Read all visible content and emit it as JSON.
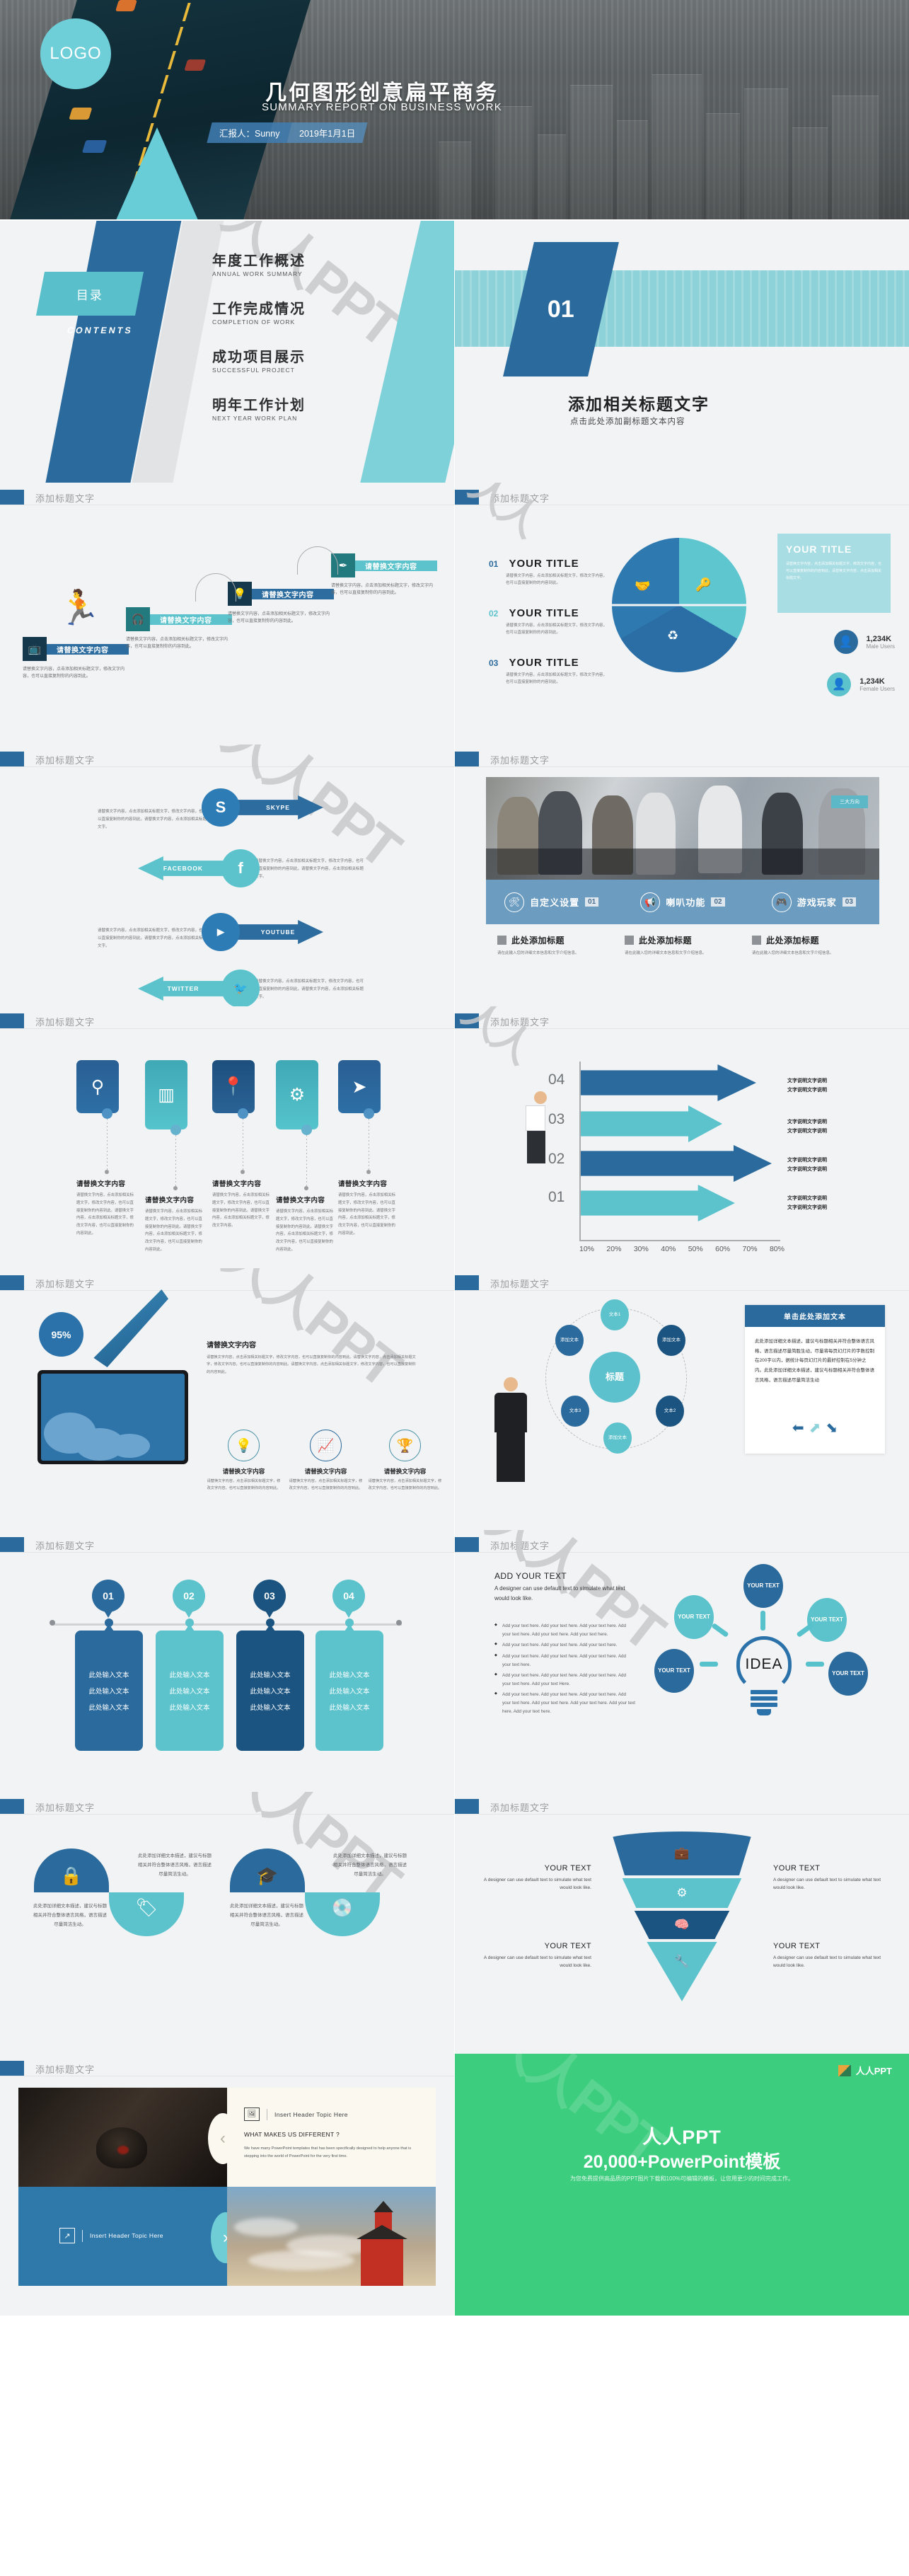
{
  "title_slide": {
    "logo": "LOGO",
    "main_title": "几何图形创意扁平商务",
    "subtitle": "SUMMARY REPORT ON BUSINESS WORK",
    "presenter": "汇报人：Sunny",
    "date": "2019年1月1日"
  },
  "contents_slide": {
    "tag": "目录",
    "contents_label": "CONTENTS",
    "items": [
      {
        "cn": "年度工作概述",
        "en": "ANNUAL WORK SUMMARY"
      },
      {
        "cn": "工作完成情况",
        "en": "COMPLETION OF WORK"
      },
      {
        "cn": "成功项目展示",
        "en": "SUCCESSFUL PROJECT"
      },
      {
        "cn": "明年工作计划",
        "en": "NEXT YEAR WORK PLAN"
      }
    ]
  },
  "section_slide": {
    "number": "01",
    "title": "添加相关标题文字",
    "subtitle": "点击此处添加副标题文本内容"
  },
  "common": {
    "slide_title": "添加标题文字",
    "replace_text": "请替换文字内容",
    "body_text": "请替换文字内容，点击添加相关标题文字，修改文字内容，也可以直接复制你的内容到此。"
  },
  "steps_slide": {
    "title": "添加标题文字",
    "steps": [
      {
        "icon": "tv-icon",
        "glyph": "📺",
        "label": "请替换文字内容",
        "desc": "请替换文字内容，点击添加相关标题文字，修改文字内容，也可以直接复制你的内容到此。"
      },
      {
        "icon": "support-icon",
        "glyph": "🎧",
        "label": "请替换文字内容",
        "desc": "请替换文字内容，点击添加相关标题文字，修改文字内容，也可以直接复制你的内容到此。"
      },
      {
        "icon": "bulb-icon",
        "glyph": "💡",
        "label": "请替换文字内容",
        "desc": "请替换文字内容，点击添加相关标题文字，修改文字内容，也可以直接复制你的内容到此。"
      },
      {
        "icon": "pen-icon",
        "glyph": "✒",
        "label": "请替换文字内容",
        "desc": "请替换文字内容，点击添加相关标题文字，修改文字内容，也可以直接复制你的内容到此。"
      }
    ]
  },
  "pie_slide": {
    "title": "添加标题文字",
    "items": [
      {
        "num": "01",
        "title": "YOUR TITLE",
        "desc": "请替换文字内容，点击添加相关标题文字，修改文字内容，也可以直接复制你的内容到此。"
      },
      {
        "num": "02",
        "title": "YOUR TITLE",
        "desc": "请替换文字内容，点击添加相关标题文字，修改文字内容，也可以直接复制你的内容到此。"
      },
      {
        "num": "03",
        "title": "YOUR TITLE",
        "desc": "请替换文字内容，点击添加相关标题文字，修改文字内容，也可以直接复制你的内容到此。"
      }
    ],
    "card_title": "YOUR TITLE",
    "card_body": "请替换文字内容，点击添加相关标题文字，修改文字内容，也可以直接复制你的内容到此，请替换文字内容，点击添加相关标题文字。",
    "stats": [
      {
        "value": "1,234K",
        "label": "Male Users"
      },
      {
        "value": "1,234K",
        "label": "Female Users"
      }
    ]
  },
  "social_slide": {
    "title": "添加标题文字",
    "rows": [
      {
        "network": "SKYPE",
        "icon": "skype-icon",
        "glyph": "S",
        "dir": "right",
        "desc": "请替换文字内容，点击添加相关标题文字，修改文字内容，也可以直接复制你的内容到此，请替换文字内容，点击添加相关标题文字。"
      },
      {
        "network": "FACEBOOK",
        "icon": "facebook-icon",
        "glyph": "f",
        "dir": "left",
        "desc": "请替换文字内容，点击添加相关标题文字，修改文字内容，也可以直接复制你的内容到此，请替换文字内容，点击添加相关标题文字。"
      },
      {
        "network": "YOUTUBE",
        "icon": "youtube-icon",
        "glyph": "▶",
        "dir": "right",
        "desc": "请替换文字内容，点击添加相关标题文字，修改文字内容，也可以直接复制你的内容到此，请替换文字内容，点击添加相关标题文字。"
      },
      {
        "network": "TWITTER",
        "icon": "twitter-icon",
        "glyph": "🐦",
        "dir": "left",
        "desc": "请替换文字内容，点击添加相关标题文字，修改文字内容，也可以直接复制你的内容到此，请替换文字内容，点击添加相关标题文字。"
      }
    ]
  },
  "meeting_slide": {
    "title": "添加标题文字",
    "photo_tag": "三大方向",
    "bar_items": [
      {
        "icon": "tools-icon",
        "glyph": "🛠",
        "label": "自定义设置",
        "num": "01"
      },
      {
        "icon": "megaphone-icon",
        "glyph": "📢",
        "label": "喇叭功能",
        "num": "02"
      },
      {
        "icon": "gamepad-icon",
        "glyph": "🎮",
        "label": "游戏玩家",
        "num": "03"
      }
    ],
    "columns": [
      {
        "head": "此处添加标题",
        "body": "请在此输入您的详细文本信息和文字介绍信息。"
      },
      {
        "head": "此处添加标题",
        "body": "请在此输入您的详细文本信息和文字介绍信息。"
      },
      {
        "head": "此处添加标题",
        "body": "请在此输入您的详细文本信息和文字介绍信息。"
      }
    ]
  },
  "icons5_slide": {
    "title": "添加标题文字",
    "items": [
      {
        "icon": "bulb-pin-icon",
        "glyph": "♀",
        "title": "请替换文字内容",
        "body": "请替换文字内容，点击添加相关标题文字，修改文字内容，也可以直接复制你的内容到此。请替换文字内容，点击添加相关标题文字，修改文字内容，也可以直接复制你的内容到此。"
      },
      {
        "icon": "bar-chart-icon",
        "glyph": "▥",
        "title": "请替换文字内容",
        "body": "请替换文字内容，点击添加相关标题文字，修改文字内容，也可以直接复制你的内容到此。请替换文字内容，点击添加相关标题文字，修改文字内容，也可以直接复制你的内容到此。"
      },
      {
        "icon": "map-pin-icon",
        "glyph": "📍",
        "title": "请替换文字内容",
        "body": "请替换文字内容，点击添加相关标题文字，修改文字内容，也可以直接复制你的内容到此。请替换文字内容，点击添加相关标题文字，修改文字内容。"
      },
      {
        "icon": "gear-icon",
        "glyph": "⚙",
        "title": "请替换文字内容",
        "body": "请替换文字内容，点击添加相关标题文字，修改文字内容，也可以直接复制你的内容到此。请替换文字内容，点击添加相关标题文字，修改文字内容，也可以直接复制你的内容到此。"
      },
      {
        "icon": "paper-plane-icon",
        "glyph": "➤",
        "title": "请替换文字内容",
        "body": "请替换文字内容，点击添加相关标题文字，修改文字内容，也可以直接复制你的内容到此。请替换文字内容，点击添加相关标题文字，修改文字内容，也可以直接复制你的内容到此。"
      }
    ]
  },
  "arrow_chart_slide": {
    "title": "添加标题文字",
    "annotations": [
      "文字说明文字说明\n文字说明文字说明",
      "文字说明文字说明\n文字说明文字说明",
      "文字说明文字说明\n文字说明文字说明",
      "文字说明文字说明\n文字说明文字说明"
    ]
  },
  "rocket_slide": {
    "title": "添加标题文字",
    "badge": "95%",
    "heading": "请替换文字内容",
    "body": "请替换文字内容，点击添加相关标题文字，修改文字内容，也可以直接复制你的内容到此。请替换文字内容，点击添加相关标题文字，修改文字内容，也可以直接复制你的内容到此。请替换文字内容，点击添加相关标题文字，修改文字内容，也可以直接复制你的内容到此。",
    "cards": [
      {
        "icon": "bulb-icon",
        "glyph": "💡",
        "title": "请替换文字内容",
        "body": "请替换文字内容，点击添加相关标题文字，修改文字内容，也可以直接复制你的内容到此。"
      },
      {
        "icon": "growth-chart-icon",
        "glyph": "📈",
        "title": "请替换文字内容",
        "body": "请替换文字内容，点击添加相关标题文字，修改文字内容，也可以直接复制你的内容到此。"
      },
      {
        "icon": "trophy-icon",
        "glyph": "🏆",
        "title": "请替换文字内容",
        "body": "请替换文字内容，点击添加相关标题文字，修改文字内容，也可以直接复制你的内容到此。"
      }
    ]
  },
  "mindmap_slide": {
    "title": "添加标题文字",
    "center": "标题",
    "nodes": [
      "文本1",
      "添加文本",
      "添加文本",
      "文本3",
      "文本2",
      "添加文本"
    ],
    "card_header": "单击此处添加文本",
    "card_body": "此处添加详细文本描述，建议与标题相关并符合整体语言风格，语言描述尽量简胜生动，尽量将每页幻灯片的字数控制在200字以内，据统计每页幻灯片的最好控制在5分钟之内。此处添加详细文本描述，建议与标题相关并符合整体语言风格，语言描述尽量简洁生动"
  },
  "timeline_slide": {
    "title": "添加标题文字",
    "steps": [
      {
        "num": "01",
        "lines": [
          "此处输入文本",
          "此处输入文本",
          "此处输入文本"
        ]
      },
      {
        "num": "02",
        "lines": [
          "此处输入文本",
          "此处输入文本",
          "此处输入文本"
        ]
      },
      {
        "num": "03",
        "lines": [
          "此处输入文本",
          "此处输入文本",
          "此处输入文本"
        ]
      },
      {
        "num": "04",
        "lines": [
          "此处输入文本",
          "此处输入文本",
          "此处输入文本"
        ]
      }
    ]
  },
  "idea_slide": {
    "title": "添加标题文字",
    "heading": "ADD YOUR TEXT",
    "subheading": "A designer can use default text to simulate what text would look like.",
    "bullets": [
      "Add your text here. Add your text here. Add your text here. Add your text here. Add your text here. Add your text here.",
      "Add your text here. Add your text here. Add your text here.",
      "Add your text here. Add your text here. Add your text here. Add your text here.",
      "Add your text here. Add your text here. Add your text here. Add your text here. Add your text Here.",
      "Add your text here. Add your text here. Add your text here. Add your text here. Add your text here. Add your text here. Add your text here. Add your text here."
    ],
    "bulb_word": "IDEA",
    "nodes": [
      "YOUR TEXT",
      "YOUR TEXT",
      "YOUR TEXT",
      "YOUR TEXT",
      "YOUR TEXT"
    ]
  },
  "semis_slide": {
    "title": "添加标题文字",
    "items": [
      {
        "icon": "lock-icon",
        "glyph": "🔒",
        "text": "此处添加详细文本描述，建议与标题相关并符合整体语言风格，语言描述尽量简洁生动。"
      },
      {
        "icon": "tag-icon",
        "glyph": "🏷",
        "text": "此处添加详细文本描述，建议与标题相关并符合整体语言风格，语言描述尽量简洁生动。"
      },
      {
        "icon": "graduation-cap-icon",
        "glyph": "🎓",
        "text": "此处添加详细文本描述，建议与标题相关并符合整体语言风格，语言描述尽量简洁生动。"
      },
      {
        "icon": "disc-icon",
        "glyph": "💿",
        "text": "此处添加详细文本描述，建议与标题相关并符合整体语言风格，语言描述尽量简洁生动。"
      }
    ]
  },
  "funnel_slide": {
    "title": "添加标题文字",
    "segments": [
      {
        "icon": "briefcase-icon",
        "glyph": "💼"
      },
      {
        "icon": "gears-icon",
        "glyph": "⚙"
      },
      {
        "icon": "head-idea-icon",
        "glyph": "🧠"
      },
      {
        "icon": "wrench-icon",
        "glyph": "🔧"
      }
    ],
    "labels": [
      {
        "head": "YOUR TEXT",
        "body": "A designer can use default text to simulate what text would look like."
      },
      {
        "head": "YOUR TEXT",
        "body": "A designer can use default text to simulate what text would look like."
      },
      {
        "head": "YOUR TEXT",
        "body": "A designer can use default text to simulate what text would look like."
      },
      {
        "head": "YOUR TEXT",
        "body": "A designer can use default text to simulate what text would look like."
      }
    ]
  },
  "gallery_slide": {
    "title": "添加标题文字",
    "card_topic": "Insert Header Topic Here",
    "card_question": "WHAT MAKES US DIFFERENT ?",
    "card_body": "We have many PowerPoint templates that has been specifically designed to help anyone that is stepping into the world of PowerPoint for the very first time.",
    "blue_topic": "Insert Header Topic Here"
  },
  "end_slide": {
    "brand": "人人PPT",
    "title": "人人PPT",
    "subtitle": "20,000+PowerPoint模板",
    "tagline": "为您免费提供高品质的PPT图片下载和100%可编辑的模板，让您用更少的时间完成工作。"
  },
  "colors": {
    "deep_blue": "#2b6a9c",
    "dark_blue": "#1b5480",
    "teal": "#5cc3cc",
    "light_teal": "#8cd2d8",
    "navy": "#16384c",
    "green": "#3dcd7e",
    "bg": "#f2f3f4"
  },
  "chart_data": {
    "type": "bar",
    "title": "添加标题文字",
    "orientation": "horizontal",
    "categories": [
      "01",
      "02",
      "03",
      "04"
    ],
    "values": [
      60,
      75,
      55,
      70
    ],
    "xlabel": "",
    "ylabel": "",
    "xticks": [
      "10%",
      "20%",
      "30%",
      "40%",
      "50%",
      "60%",
      "70%",
      "80%"
    ],
    "xlim": [
      0,
      80
    ],
    "grid": false,
    "legend": false,
    "series_colors": [
      "#5cc3cc",
      "#2b6a9c",
      "#5cc3cc",
      "#2b6a9c"
    ],
    "annotations": [
      "文字说明文字说明文字说明文字说明",
      "文字说明文字说明文字说明文字说明",
      "文字说明文字说明文字说明文字说明",
      "文字说明文字说明文字说明文字说明"
    ]
  }
}
